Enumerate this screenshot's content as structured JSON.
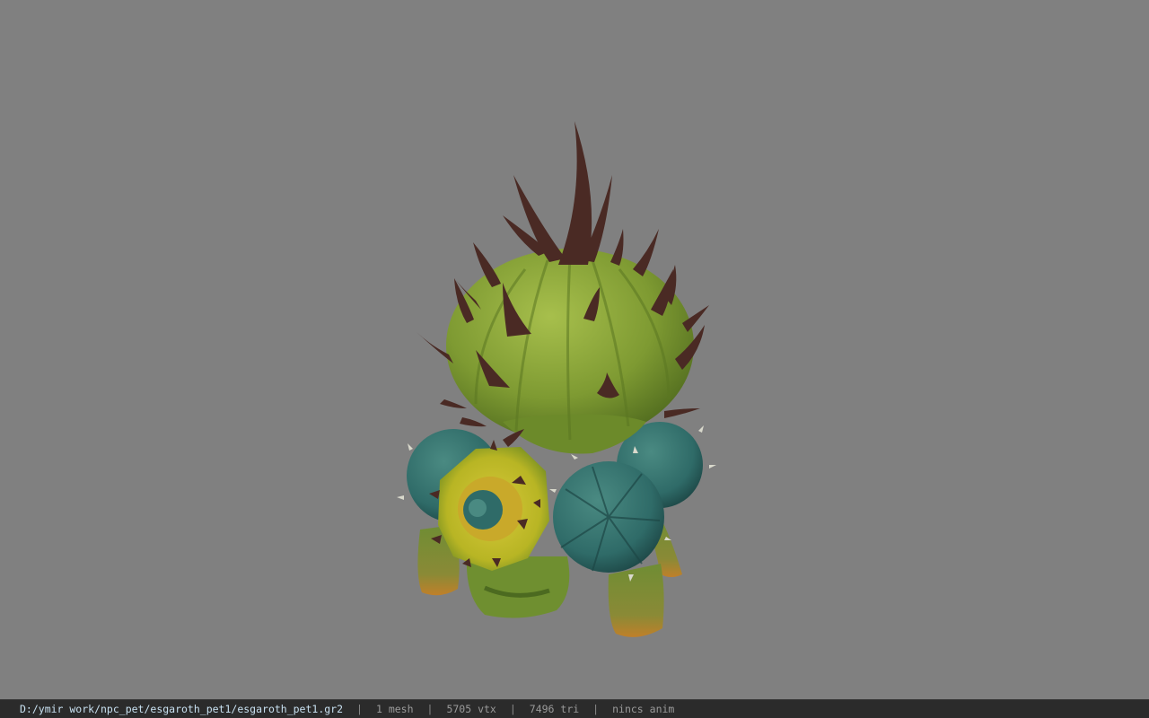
{
  "status_bar": {
    "file_path": "D:/ymir work/npc_pet/esgaroth_pet1/esgaroth_pet1.gr2",
    "separator": "|",
    "mesh_count": "1 mesh",
    "vertex_count": "5705 vtx",
    "triangle_count": "7496 tri",
    "animation": "nincs anim"
  },
  "viewport": {
    "background_color": "#808080",
    "model": "cactus-pet-model"
  },
  "colors": {
    "cactus_body": "#7e9a32",
    "cactus_highlight": "#a7bf4c",
    "cactus_dark": "#4f6a1e",
    "spine": "#4a2a24",
    "teal_ball": "#2f6b68",
    "yellow_flower": "#b8b524",
    "statusbar_bg": "#2b2b2b",
    "path_text": "#c8e0f0"
  }
}
